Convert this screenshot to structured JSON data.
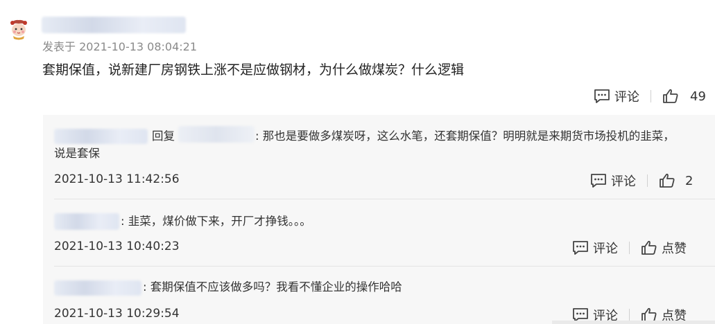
{
  "comment": {
    "posted_time": "发表于 2021-10-13 08:04:21",
    "text": "套期保值，说新建厂房钢铁上涨不是应做钢材，为什么做煤炭？什么逻辑",
    "comment_label": "评论",
    "like_count": "49"
  },
  "replies": [
    {
      "reply_word": "回复",
      "text_line1": ": 那也是要做多煤炭呀，这么水笔，还套期保值？明明就是来期货市场投机的韭菜，",
      "text_line2": "说是套保",
      "time": "2021-10-13 11:42:56",
      "comment_label": "评论",
      "like_label": "2"
    },
    {
      "text": ": 韭菜，煤价做下来，开厂才挣钱。。。",
      "time": "2021-10-13 10:40:23",
      "comment_label": "评论",
      "like_label": "点赞"
    },
    {
      "text": ": 套期保值不应该做多吗？我看不懂企业的操作哈哈",
      "time": "2021-10-13 10:29:54",
      "comment_label": "评论",
      "like_label": "点赞"
    }
  ]
}
